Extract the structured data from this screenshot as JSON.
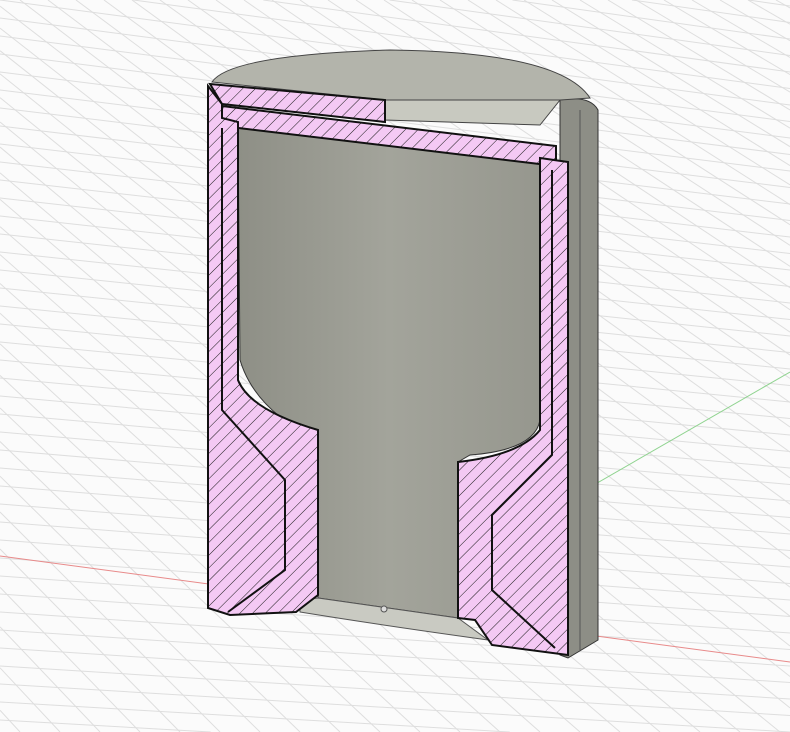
{
  "viewport": {
    "view_type": "section-analysis",
    "colors": {
      "background": "#fbfbfb",
      "grid": "#dcdcdc",
      "x_axis": "#e88a8a",
      "y_axis": "#8fd38f",
      "section_fill": "#f4c9f4",
      "hatch": "#1a1a1a",
      "body": "#a9aaa0",
      "body_dark": "#7f8078",
      "cavity": "#9c9d94"
    }
  }
}
